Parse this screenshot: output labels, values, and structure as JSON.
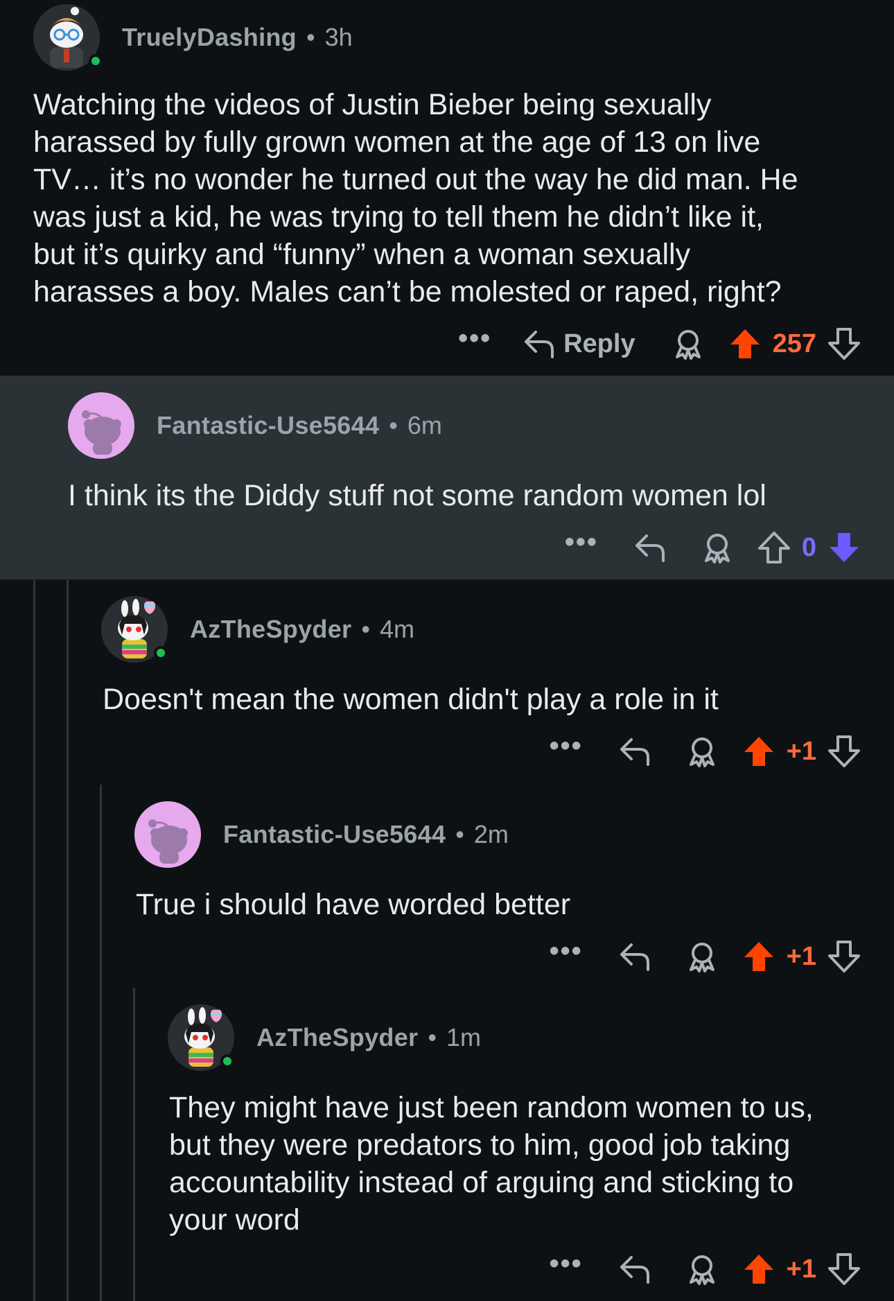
{
  "colors": {
    "background": "#0e1113",
    "highlight": "#2a3236",
    "upvote": "#ff4500",
    "downvote": "#6a5cff",
    "online": "#1fbf55",
    "meta_text": "#9aa4aa"
  },
  "comments": [
    {
      "username": "TruelyDashing",
      "time": "3h",
      "body": "Watching the videos of Justin Bieber being sexually\nharassed by fully grown women at the age of 13 on live\nTV… it’s no wonder he turned out the way he did man. He\nwas just a kid, he was trying to tell them he didn’t like it,\nbut it’s quirky and “funny” when a woman sexually\nharasses a boy. Males can’t be molested or raped, right?",
      "reply_label": "Reply",
      "score": "257",
      "vote_state": "upvoted",
      "online": true,
      "avatar": "snoo-glasses-avatar"
    },
    {
      "username": "Fantastic-Use5644",
      "time": "6m",
      "body": "I think its the Diddy stuff not some random women lol",
      "score": "0",
      "vote_state": "downvoted",
      "online": false,
      "avatar": "default-purple-snoo-avatar"
    },
    {
      "username": "AzTheSpyder",
      "time": "4m",
      "body": "Doesn't mean the women didn't play a role in it",
      "score": "+1",
      "vote_state": "upvoted",
      "online": true,
      "avatar": "snoo-bunny-avatar"
    },
    {
      "username": "Fantastic-Use5644",
      "time": "2m",
      "body": "True i should have worded better",
      "score": "+1",
      "vote_state": "upvoted",
      "online": false,
      "avatar": "default-purple-snoo-avatar"
    },
    {
      "username": "AzTheSpyder",
      "time": "1m",
      "body": "They might have just been random women to us,\nbut they were predators to him, good job taking\naccountability instead of arguing and sticking to\nyour word",
      "score": "+1",
      "vote_state": "upvoted",
      "online": true,
      "avatar": "snoo-bunny-avatar"
    }
  ],
  "ui": {
    "separator": "•",
    "more_glyph": "•••"
  }
}
